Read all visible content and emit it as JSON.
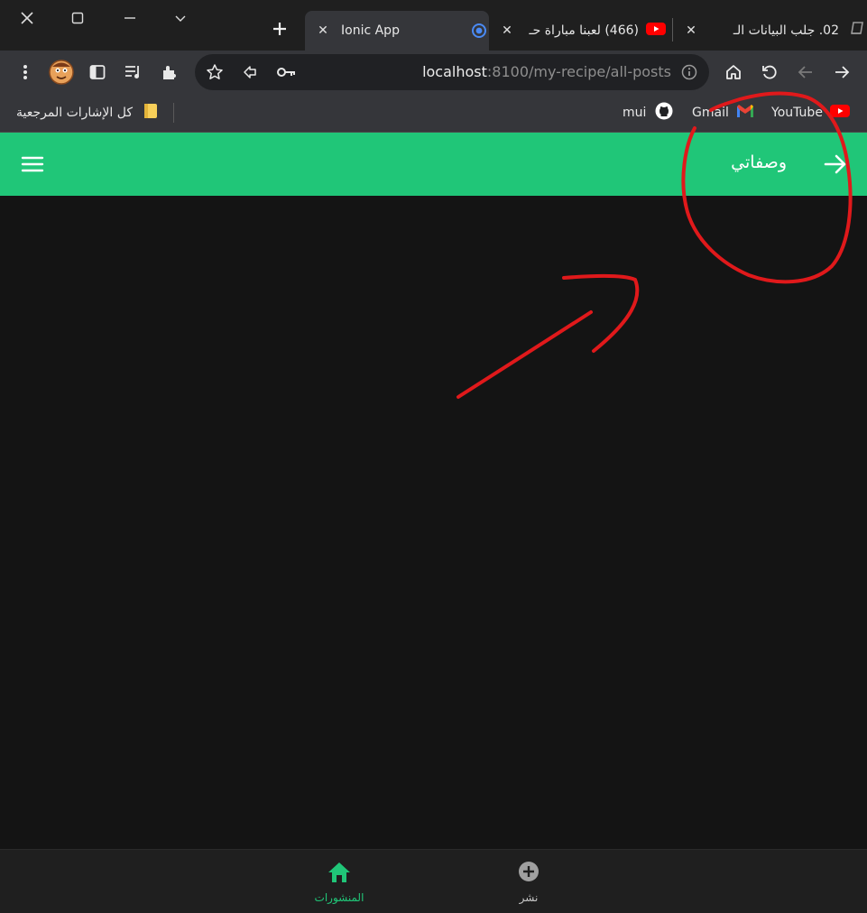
{
  "colors": {
    "accent": "#20c678",
    "annotation": "#e0191b",
    "tab_active_bg": "#35363a",
    "page_bg": "#141414"
  },
  "tabs": [
    {
      "title": "Ionic App",
      "icon": "ionic-icon",
      "active": true
    },
    {
      "title": "(466) لعبنا مباراة حـ",
      "icon": "youtube-icon",
      "active": false
    },
    {
      "title": "02. جلب البيانات الـ",
      "icon": "site-icon",
      "active": false
    }
  ],
  "toolbar": {
    "url_host": "localhost",
    "url_path": ":8100/my-recipe/all-posts"
  },
  "bookmarks": {
    "all_bookmarks_label": "كل الإشارات المرجعية",
    "items": [
      {
        "label": "YouTube",
        "icon": "youtube-icon"
      },
      {
        "label": "Gmail",
        "icon": "gmail-icon"
      },
      {
        "label": "mui",
        "icon": "github-icon"
      }
    ]
  },
  "app": {
    "header_title": "وصفاتي",
    "back_icon": "arrow-right-icon",
    "menu_icon": "menu-icon"
  },
  "tabbar": {
    "items": [
      {
        "label": "المنشورات",
        "icon": "home-icon",
        "active": true
      },
      {
        "label": "نشر",
        "icon": "add-circle-icon",
        "active": false
      }
    ]
  }
}
